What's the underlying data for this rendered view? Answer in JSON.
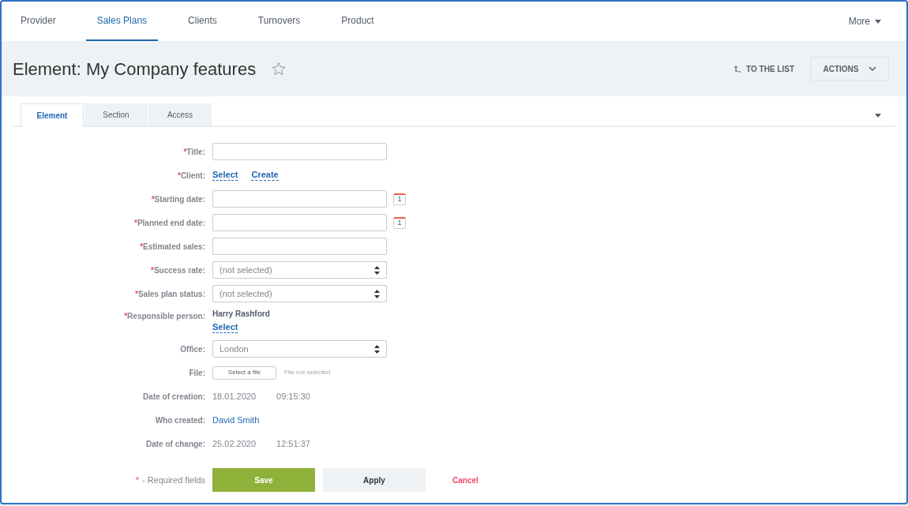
{
  "nav": {
    "items": [
      {
        "label": "Provider",
        "selected": false
      },
      {
        "label": "Sales Plans",
        "selected": true
      },
      {
        "label": "Clients",
        "selected": false
      },
      {
        "label": "Turnovers",
        "selected": false
      },
      {
        "label": "Product",
        "selected": false
      }
    ],
    "more": "More"
  },
  "header": {
    "title": "Element: My Company features",
    "to_list": "TO THE LIST",
    "actions": "ACTIONS"
  },
  "tabs": [
    {
      "label": "Element",
      "selected": true
    },
    {
      "label": "Section",
      "selected": false
    },
    {
      "label": "Access",
      "selected": false
    }
  ],
  "fields": [
    {
      "kind": "input",
      "mark": "*",
      "label": "Title:"
    },
    {
      "kind": "links",
      "mark": "*",
      "label": "Client:",
      "links": [
        "Select",
        "Create"
      ]
    },
    {
      "kind": "date",
      "mark": "*",
      "label": "Starting date:",
      "calendar_day": "1"
    },
    {
      "kind": "date",
      "mark": "*",
      "label": "Planned end date:",
      "calendar_day": "1"
    },
    {
      "kind": "input",
      "mark": "*",
      "label": "Estimated sales:"
    },
    {
      "kind": "select",
      "mark": "*",
      "label": "Success rate:",
      "value": "(not selected)"
    },
    {
      "kind": "select",
      "mark": "*",
      "label": "Sales plan status:",
      "value": "(not selected)"
    },
    {
      "kind": "person",
      "mark": "*",
      "label": "Responsible person:",
      "value": "Harry Rashford",
      "link": "Select"
    },
    {
      "kind": "select",
      "label": "Office:",
      "value": "London"
    },
    {
      "kind": "file",
      "label": "File:",
      "button": "Select a file",
      "note": "File not selected"
    },
    {
      "kind": "info",
      "label": "Date of creation:",
      "date": "18.01.2020",
      "time": "09:15:30"
    },
    {
      "kind": "user",
      "label": "Who created:",
      "value": "David Smith"
    },
    {
      "kind": "info",
      "label": "Date of change:",
      "date": "25.02.2020",
      "time": "12:51:37"
    }
  ],
  "footer": {
    "mark": "*",
    "note": "- Required fields",
    "save": "Save",
    "apply": "Apply",
    "cancel": "Cancel"
  }
}
